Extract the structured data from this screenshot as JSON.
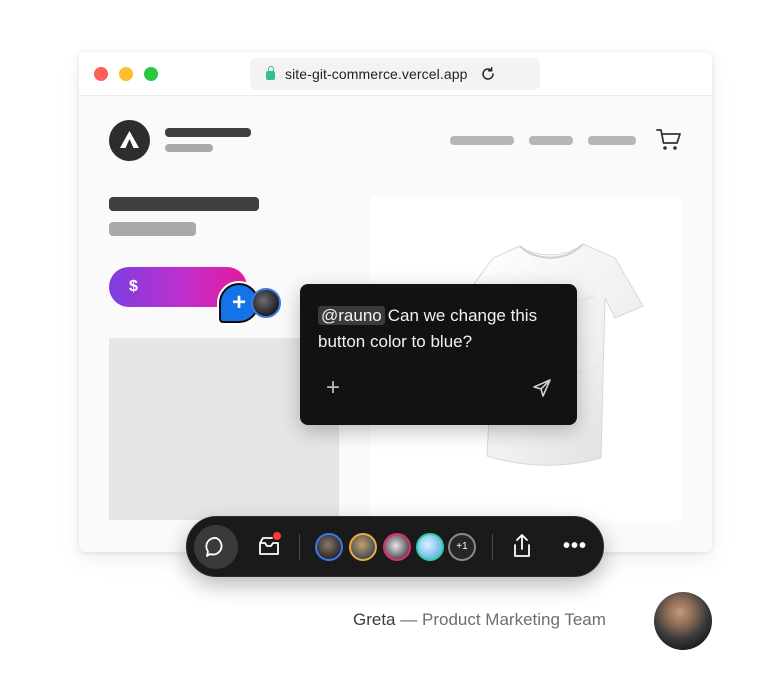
{
  "browser": {
    "url": "site-git-commerce.vercel.app",
    "icons": [
      "lock-icon",
      "reload-icon"
    ]
  },
  "store": {
    "buy_button_label": "$",
    "icons": [
      "logo-icon",
      "cart-icon"
    ]
  },
  "comment": {
    "mention": "@rauno",
    "text": "Can we change this button color to blue?",
    "pin_label": "+",
    "add_label": "+"
  },
  "toolbar": {
    "overflow_count": "+1",
    "more_label": "•••",
    "icons": [
      "chat-icon",
      "inbox-icon",
      "share-icon",
      "more-icon"
    ]
  },
  "credit": {
    "name": "Greta",
    "separator": " — ",
    "role": "Product Marketing Team"
  },
  "colors": {
    "button_gradient": [
      "#7c3ee0",
      "#c12fcc",
      "#e4199a"
    ],
    "pin_blue": "#1473e6",
    "comment_bg": "#121212",
    "toolbar_bg": "#1a1a1a",
    "notification_red": "#ff3a3a"
  }
}
